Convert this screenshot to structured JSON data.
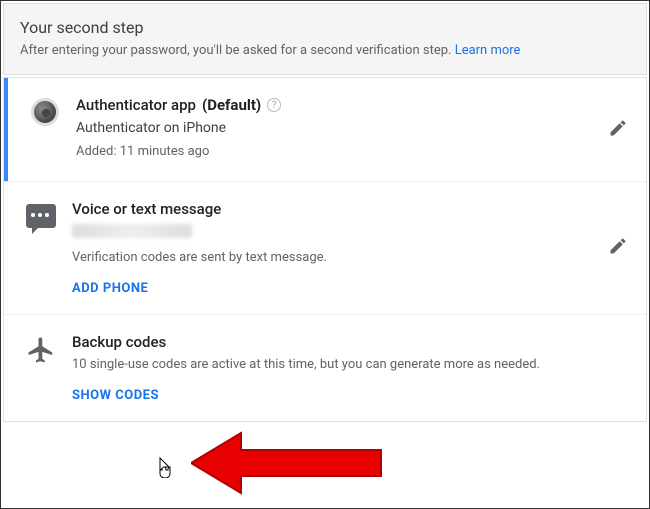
{
  "header": {
    "title": "Your second step",
    "subtitle": "After entering your password, you'll be asked for a second verification step. ",
    "learn_more": "Learn more"
  },
  "authenticator": {
    "title": "Authenticator app",
    "default_tag": "(Default)",
    "device": "Authenticator on iPhone",
    "added": "Added: 11 minutes ago"
  },
  "voice": {
    "title": "Voice or text message",
    "desc": "Verification codes are sent by text message.",
    "add_phone": "ADD PHONE"
  },
  "backup": {
    "title": "Backup codes",
    "desc": "10 single-use codes are active at this time, but you can generate more as needed.",
    "show_codes": "SHOW CODES"
  }
}
